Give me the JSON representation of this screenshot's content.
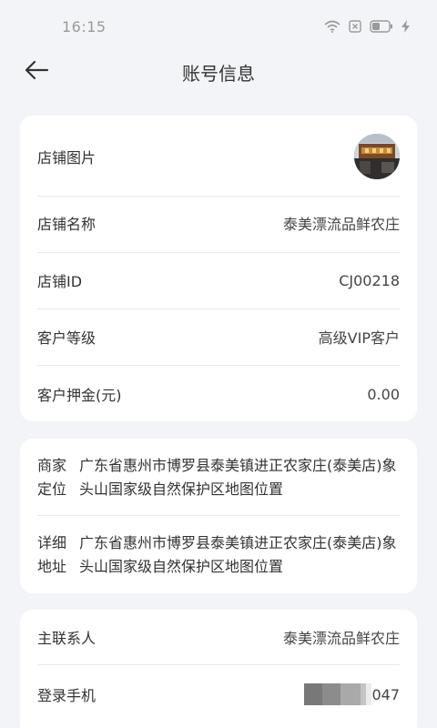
{
  "status_bar": {
    "time": "16:15",
    "icons": [
      "wifi-icon",
      "sim-disabled-icon",
      "battery-icon",
      "charging-icon"
    ]
  },
  "header": {
    "title": "账号信息",
    "back_icon": "arrow-left-icon"
  },
  "store_info": {
    "store_image_label": "店铺图片",
    "store_name_label": "店铺名称",
    "store_name_value": "泰美漂流品鲜农庄",
    "store_id_label": "店铺ID",
    "store_id_value": "CJ00218",
    "customer_level_label": "客户等级",
    "customer_level_value": "高级VIP客户",
    "deposit_label": "客户押金(元)",
    "deposit_value": "0.00"
  },
  "address_info": {
    "location_label": "商家定位",
    "location_value": "广东省惠州市博罗县泰美镇进正农家庄(泰美店)象头山国家级自然保护区地图位置",
    "detail_label": "详细地址",
    "detail_value": "广东省惠州市博罗县泰美镇进正农家庄(泰美店)象头山国家级自然保护区地图位置"
  },
  "contact_info": {
    "contact_label": "主联系人",
    "contact_value": "泰美漂流品鲜农庄",
    "phone_label": "登录手机",
    "phone_suffix": "047"
  },
  "colors": {
    "background": "#f2f4f7",
    "card": "#ffffff",
    "divider": "#e9e9e9",
    "status_gray": "#9a9a9a"
  }
}
